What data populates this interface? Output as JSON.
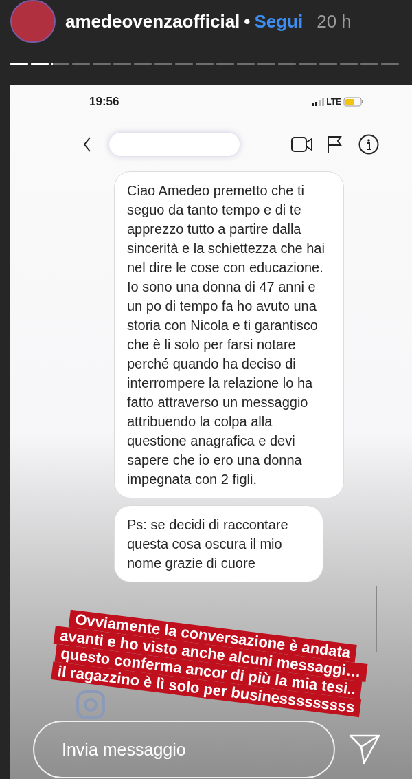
{
  "story_header": {
    "username": "amedeovenzaofficial",
    "separator": "•",
    "follow": "Segui",
    "time": "20 h"
  },
  "progress_segments": [
    {
      "level": 1
    },
    {
      "level": 1
    },
    {
      "level": 0.06
    },
    {
      "level": 0
    },
    {
      "level": 0
    },
    {
      "level": 0
    },
    {
      "level": 0
    },
    {
      "level": 0
    },
    {
      "level": 0
    },
    {
      "level": 0
    },
    {
      "level": 0
    },
    {
      "level": 0
    },
    {
      "level": 0
    },
    {
      "level": 0
    },
    {
      "level": 0
    },
    {
      "level": 0
    },
    {
      "level": 0
    },
    {
      "level": 0
    },
    {
      "level": 0
    }
  ],
  "phone_status": {
    "time": "19:56",
    "network": "LTE"
  },
  "messages": [
    "Ciao Amedeo premetto che ti seguo da tanto tempo e di te apprezzo tutto a partire dalla sincerità e la schiettezza che hai nel dire le cose con educazione. Io sono una donna di 47 anni e un po di tempo fa ho avuto una storia con Nicola e ti garantisco che è li solo per farsi notare perché quando ha deciso di interrompere la relazione lo ha fatto attraverso un messaggio attribuendo la colpa alla questione anagrafica e devi sapere che io ero una donna impegnata con 2 figli.",
    "Ps: se decidi di raccontare questa cosa oscura il mio nome grazie di cuore"
  ],
  "caption_lines": [
    "Ovviamente la conversazione è andata",
    "avanti e ho visto anche alcuni messaggi…",
    "questo conferma ancor di più la mia tesi..",
    "il ragazzino è lì solo per businesssssssss"
  ],
  "reply": {
    "placeholder": "Invia messaggio"
  }
}
